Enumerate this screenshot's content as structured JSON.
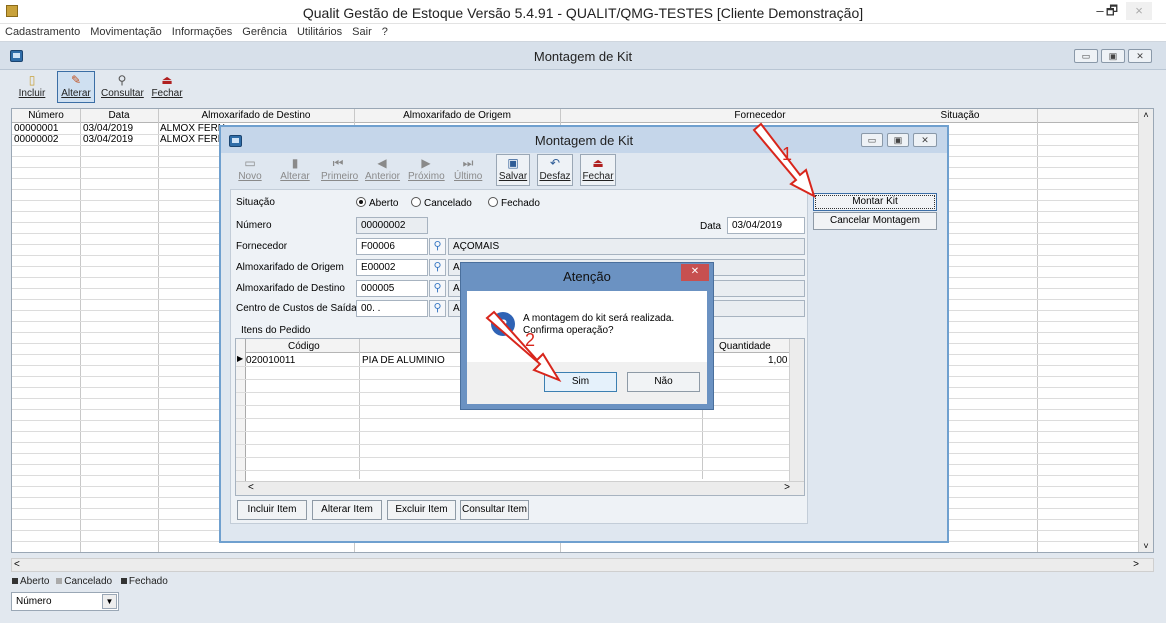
{
  "app": {
    "title": "Qualit Gestão de Estoque Versão 5.4.91 - QUALIT/QMG-TESTES [Cliente Demonstração]",
    "window_controls": [
      "–",
      "🗗",
      "×"
    ]
  },
  "menu": [
    "Cadastramento",
    "Movimentação",
    "Informações",
    "Gerência",
    "Utilitários",
    "Sair",
    "?"
  ],
  "main_window": {
    "title": "Montagem de Kit",
    "toolbar": [
      {
        "label": "Incluir",
        "icon": "new-icon"
      },
      {
        "label": "Alterar",
        "icon": "edit-icon"
      },
      {
        "label": "Consultar",
        "icon": "search-icon"
      },
      {
        "label": "Fechar",
        "icon": "exit-icon"
      }
    ],
    "grid": {
      "columns": [
        "Número",
        "Data",
        "Almoxarifado de Destino",
        "Almoxarifado de Origem",
        "Fornecedor",
        "Situação"
      ],
      "rows": [
        [
          "00000001",
          "03/04/2019",
          "ALMOX FERN"
        ],
        [
          "00000002",
          "03/04/2019",
          "ALMOX FERN"
        ]
      ]
    },
    "legend": [
      "Aberto",
      "Cancelado",
      "Fechado"
    ],
    "sort_combo": "Número"
  },
  "kit_dialog": {
    "title": "Montagem de Kit",
    "toolbar": [
      {
        "label": "Novo",
        "enabled": false
      },
      {
        "label": "Alterar",
        "enabled": false
      },
      {
        "label": "Primeiro",
        "enabled": false
      },
      {
        "label": "Anterior",
        "enabled": false
      },
      {
        "label": "Próximo",
        "enabled": false
      },
      {
        "label": "Último",
        "enabled": false
      },
      {
        "label": "Salvar",
        "enabled": true
      },
      {
        "label": "Desfaz",
        "enabled": true
      },
      {
        "label": "Fechar",
        "enabled": true
      }
    ],
    "situacao_label": "Situação",
    "situacao_options": [
      "Aberto",
      "Cancelado",
      "Fechado"
    ],
    "situacao_selected": "Aberto",
    "numero_label": "Número",
    "numero": "00000002",
    "data_label": "Data",
    "data": "03/04/2019",
    "fornecedor_label": "Fornecedor",
    "fornecedor_code": "F00006",
    "fornecedor_name": "AÇOMAIS",
    "origem_label": "Almoxarifado de Origem",
    "origem_code": "E00002",
    "origem_name": "ALMOXARIFADO CENTRAL",
    "destino_label": "Almoxarifado de Destino",
    "destino_code": "000005",
    "destino_name": "AL",
    "centro_label": "Centro de Custos de Saída",
    "centro_code": "00.  .",
    "centro_name": "AL",
    "items_label": "Itens do Pedido",
    "items_columns": [
      "Código",
      "",
      "Quantidade"
    ],
    "items": [
      {
        "codigo": "020010011",
        "descricao": "PIA DE ALUMINIO",
        "quantidade": "1,00"
      }
    ],
    "item_buttons": [
      "Incluir Item",
      "Alterar Item",
      "Excluir Item",
      "Consultar Item"
    ],
    "side_buttons": [
      "Montar Kit",
      "Cancelar Montagem"
    ]
  },
  "confirm": {
    "title": "Atenção",
    "message_line1": "A montagem do kit será realizada.",
    "message_line2": "Confirma operação?",
    "yes": "Sim",
    "no": "Não"
  },
  "annotations": [
    "1",
    "2"
  ],
  "colors": {
    "annotation_red": "#d8261c",
    "dialog_border": "#6fa0cf",
    "confirm_frame": "#6b92c2"
  }
}
